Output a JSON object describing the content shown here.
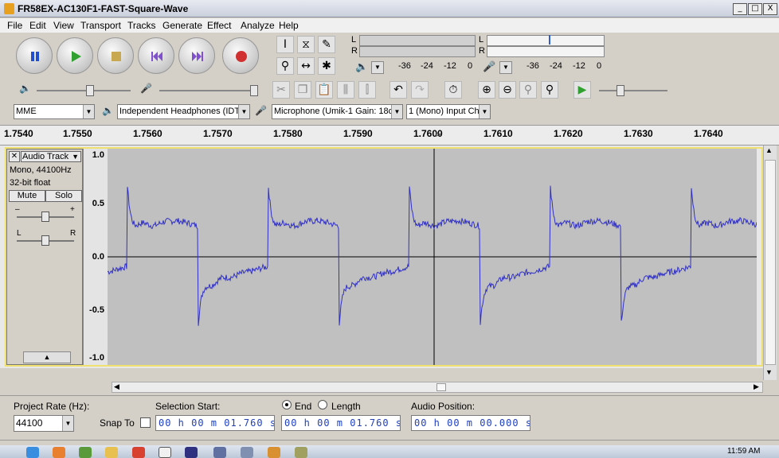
{
  "window": {
    "title": "FR58EX-AC130F1-FAST-Square-Wave",
    "min": "_",
    "max": "□",
    "close": "X"
  },
  "menu": [
    "File",
    "Edit",
    "View",
    "Transport",
    "Tracks",
    "Generate",
    "Effect",
    "Analyze",
    "Help"
  ],
  "meters": {
    "playback": {
      "l": "L",
      "r": "R",
      "ticks": [
        "-36",
        "-24",
        "-12",
        "0"
      ]
    },
    "record": {
      "l": "L",
      "r": "R",
      "ticks": [
        "-36",
        "-24",
        "-12",
        "0"
      ]
    }
  },
  "device": {
    "host": "MME",
    "output": "Independent Headphones (IDT",
    "input": "Microphone (Umik-1  Gain: 18d",
    "channels": "1 (Mono) Input Ch"
  },
  "ruler": {
    "ticks": [
      "1.7540",
      "1.7550",
      "1.7560",
      "1.7570",
      "1.7580",
      "1.7590",
      "1.7600",
      "1.7610",
      "1.7620",
      "1.7630",
      "1.7640"
    ]
  },
  "track": {
    "name": "Audio Track",
    "info1": "Mono, 44100Hz",
    "info2": "32-bit float",
    "mute": "Mute",
    "solo": "Solo",
    "gain_minus": "–",
    "gain_plus": "+",
    "pan_l": "L",
    "pan_r": "R",
    "y_labels": [
      "1.0",
      "0.5",
      "0.0",
      "-0.5",
      "-1.0"
    ]
  },
  "selection": {
    "project_rate_label": "Project Rate (Hz):",
    "project_rate": "44100",
    "snap_to": "Snap To",
    "selection_start_label": "Selection Start:",
    "end_label": "End",
    "length_label": "Length",
    "audio_position_label": "Audio Position:",
    "start_value": "00 h 00 m 01.760 s",
    "end_value": "00 h 00 m 01.760 s",
    "position_value": "00 h 00 m 00.000 s"
  },
  "taskbar": {
    "clock": "11:59 AM"
  },
  "colors": {
    "waveform": "#3030c8",
    "wave_bg": "#c0c0c0",
    "track_border": "#f0e070"
  }
}
